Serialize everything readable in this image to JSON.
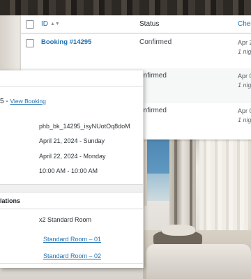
{
  "table": {
    "columns": {
      "id": "ID",
      "status": "Status",
      "check": "Chec"
    },
    "rows": [
      {
        "id": "Booking #14295",
        "status": "Confirmed",
        "check_date": "Apr 2",
        "nights": "1 nig"
      },
      {
        "id": "",
        "status": "onfirmed",
        "check_date": "Apr 0",
        "nights": "1 nig"
      },
      {
        "id": "",
        "status": "onfirmed",
        "check_date": "Apr 0",
        "nights": "1 nig"
      }
    ]
  },
  "detail": {
    "title_fragment": "5 - ",
    "view_link": "View Booking",
    "booking_key": "phb_bk_14295_isyNUotOq8doM",
    "check_in": "April 21, 2024 - Sunday",
    "check_out": "April 22, 2024 - Monday",
    "time": "10:00 AM - 10:00 AM",
    "section_title": "lations",
    "room_summary": "x2 Standard Room",
    "rooms": [
      "Standard Room – 01",
      "Standard Room – 02"
    ]
  },
  "colors": {
    "link": "#2271b1",
    "text": "#1d2327",
    "panel": "#ffffff"
  }
}
